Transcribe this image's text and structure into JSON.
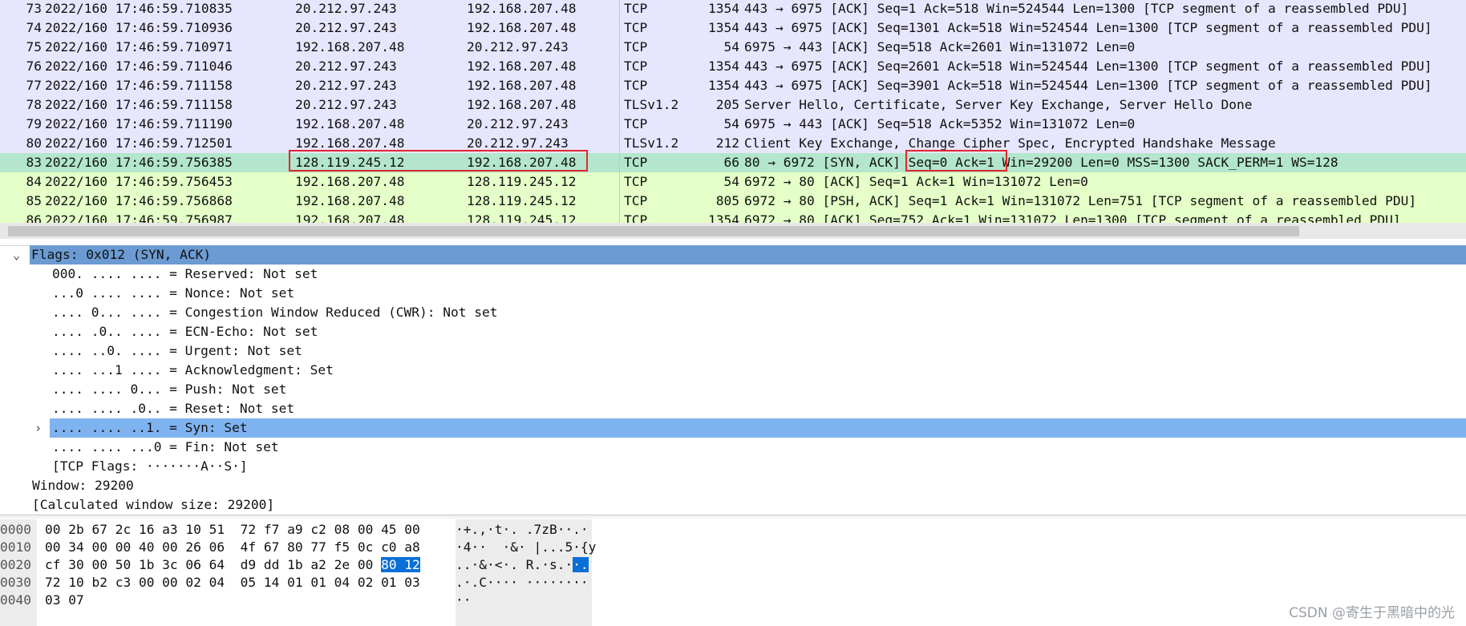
{
  "packet_list": {
    "rows": [
      {
        "no": "73",
        "time": "2022/160 17:46:59.710835",
        "src": "20.212.97.243",
        "dst": "192.168.207.48",
        "proto": "TCP",
        "len": "1354",
        "info": "443 → 6975 [ACK] Seq=1 Ack=518 Win=524544 Len=1300 [TCP segment of a reassembled PDU]",
        "color": "#e7e6ff"
      },
      {
        "no": "74",
        "time": "2022/160 17:46:59.710936",
        "src": "20.212.97.243",
        "dst": "192.168.207.48",
        "proto": "TCP",
        "len": "1354",
        "info": "443 → 6975 [ACK] Seq=1301 Ack=518 Win=524544 Len=1300 [TCP segment of a reassembled PDU]",
        "color": "#e7e6ff"
      },
      {
        "no": "75",
        "time": "2022/160 17:46:59.710971",
        "src": "192.168.207.48",
        "dst": "20.212.97.243",
        "proto": "TCP",
        "len": "54",
        "info": "6975 → 443 [ACK] Seq=518 Ack=2601 Win=131072 Len=0",
        "color": "#e7e6ff"
      },
      {
        "no": "76",
        "time": "2022/160 17:46:59.711046",
        "src": "20.212.97.243",
        "dst": "192.168.207.48",
        "proto": "TCP",
        "len": "1354",
        "info": "443 → 6975 [ACK] Seq=2601 Ack=518 Win=524544 Len=1300 [TCP segment of a reassembled PDU]",
        "color": "#e7e6ff"
      },
      {
        "no": "77",
        "time": "2022/160 17:46:59.711158",
        "src": "20.212.97.243",
        "dst": "192.168.207.48",
        "proto": "TCP",
        "len": "1354",
        "info": "443 → 6975 [ACK] Seq=3901 Ack=518 Win=524544 Len=1300 [TCP segment of a reassembled PDU]",
        "color": "#e7e6ff"
      },
      {
        "no": "78",
        "time": "2022/160 17:46:59.711158",
        "src": "20.212.97.243",
        "dst": "192.168.207.48",
        "proto": "TLSv1.2",
        "len": "205",
        "info": "Server Hello, Certificate, Server Key Exchange, Server Hello Done",
        "color": "#e7e6ff"
      },
      {
        "no": "79",
        "time": "2022/160 17:46:59.711190",
        "src": "192.168.207.48",
        "dst": "20.212.97.243",
        "proto": "TCP",
        "len": "54",
        "info": "6975 → 443 [ACK] Seq=518 Ack=5352 Win=131072 Len=0",
        "color": "#e7e6ff"
      },
      {
        "no": "80",
        "time": "2022/160 17:46:59.712501",
        "src": "192.168.207.48",
        "dst": "20.212.97.243",
        "proto": "TLSv1.2",
        "len": "212",
        "info": "Client Key Exchange, Change Cipher Spec, Encrypted Handshake Message",
        "color": "#e7e6ff"
      },
      {
        "no": "83",
        "time": "2022/160 17:46:59.756385",
        "src": "128.119.245.12",
        "dst": "192.168.207.48",
        "proto": "TCP",
        "len": "66",
        "info": "80 → 6972 [SYN, ACK] Seq=0 Ack=1 Win=29200 Len=0 MSS=1300 SACK_PERM=1 WS=128",
        "color": "#b3e6cc",
        "selected": true
      },
      {
        "no": "84",
        "time": "2022/160 17:46:59.756453",
        "src": "192.168.207.48",
        "dst": "128.119.245.12",
        "proto": "TCP",
        "len": "54",
        "info": "6972 → 80 [ACK] Seq=1 Ack=1 Win=131072 Len=0",
        "color": "#e4ffc7"
      },
      {
        "no": "85",
        "time": "2022/160 17:46:59.756868",
        "src": "192.168.207.48",
        "dst": "128.119.245.12",
        "proto": "TCP",
        "len": "805",
        "info": "6972 → 80 [PSH, ACK] Seq=1 Ack=1 Win=131072 Len=751 [TCP segment of a reassembled PDU]",
        "color": "#e4ffc7"
      },
      {
        "no": "86",
        "time": "2022/160 17:46:59.756987",
        "src": "192.168.207.48",
        "dst": "128.119.245.12",
        "proto": "TCP",
        "len": "1354",
        "info": "6972 → 80 [ACK] Seq=752 Ack=1 Win=131072 Len=1300 [TCP segment of a reassembled PDU]",
        "color": "#e4ffc7"
      }
    ]
  },
  "details": {
    "header": "Flags: 0x012 (SYN, ACK)",
    "header_color": "#6b9bd2",
    "bits": [
      {
        "text": "000. .... .... = Reserved: Not set"
      },
      {
        "text": "...0 .... .... = Nonce: Not set"
      },
      {
        "text": ".... 0... .... = Congestion Window Reduced (CWR): Not set"
      },
      {
        "text": ".... .0.. .... = ECN-Echo: Not set"
      },
      {
        "text": ".... ..0. .... = Urgent: Not set"
      },
      {
        "text": ".... ...1 .... = Acknowledgment: Set"
      },
      {
        "text": ".... .... 0... = Push: Not set"
      },
      {
        "text": ".... .... .0.. = Reset: Not set"
      },
      {
        "text": ".... .... ..1. = Syn: Set",
        "selected": true
      },
      {
        "text": ".... .... ...0 = Fin: Not set"
      },
      {
        "text": "[TCP Flags: ·······A··S·]"
      }
    ],
    "selected_color": "#7fb3f0",
    "window": "Window: 29200",
    "calc_window": "[Calculated window size: 29200]"
  },
  "bytes": {
    "rows": [
      {
        "offset": "0000",
        "hex_a": "00 2b 67 2c 16 a3 10 51  72 f7 a9 c2 08 00 45 00",
        "hex_sel": "",
        "ascii_a": "·+.,·t·. .7zB··.·",
        "ascii_sel": ""
      },
      {
        "offset": "0010",
        "hex_a": "00 34 00 00 40 00 26 06  4f 67 80 77 f5 0c c0 a8",
        "hex_sel": "",
        "ascii_a": "·4··  ·&· |...5·{y",
        "ascii_sel": ""
      },
      {
        "offset": "0020",
        "hex_a": "cf 30 00 50 1b 3c 06 64  d9 dd 1b a2 2e 00 ",
        "hex_sel": "80 12",
        "ascii_a": "..·&·<·. R.·s.·",
        "ascii_sel": "·."
      },
      {
        "offset": "0030",
        "hex_a": "72 10 b2 c3 00 00 02 04  05 14 01 01 04 02 01 03",
        "hex_sel": "",
        "ascii_a": ".·.C···· ········",
        "ascii_sel": ""
      },
      {
        "offset": "0040",
        "hex_a": "03 07",
        "hex_sel": "",
        "ascii_a": "··",
        "ascii_sel": ""
      }
    ]
  },
  "watermark": "CSDN @寄生于黑暗中的光"
}
